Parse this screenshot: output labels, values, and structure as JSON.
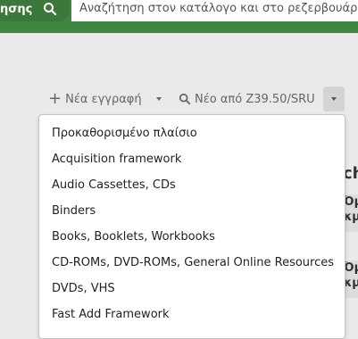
{
  "header": {
    "search_button_label": "ησης",
    "search_placeholder": "Αναζήτηση στον κατάλογο και στο ρεζερβουάρ"
  },
  "toolbar": {
    "new_record_label": "Νέα εγγραφή",
    "z3950_label": "Νέο από Z39.50/SRU"
  },
  "frameworks_menu": {
    "items": [
      "Προκαθορισμένο πλαίσιο",
      "Acquisition framework",
      "Audio Cassettes, CDs",
      "Binders",
      "Books, Booklets, Workbooks",
      "CD-ROMs, DVD-ROMs, General Online Resources",
      "DVDs, VHS",
      "Fast Add Framework"
    ]
  },
  "background": {
    "heading_fragment": "ch",
    "cell_fragment_top": "Όμ",
    "cell_fragment_bottom": "κμ"
  },
  "colors": {
    "header_green": "#408540",
    "page_background": "#eaeaea"
  }
}
